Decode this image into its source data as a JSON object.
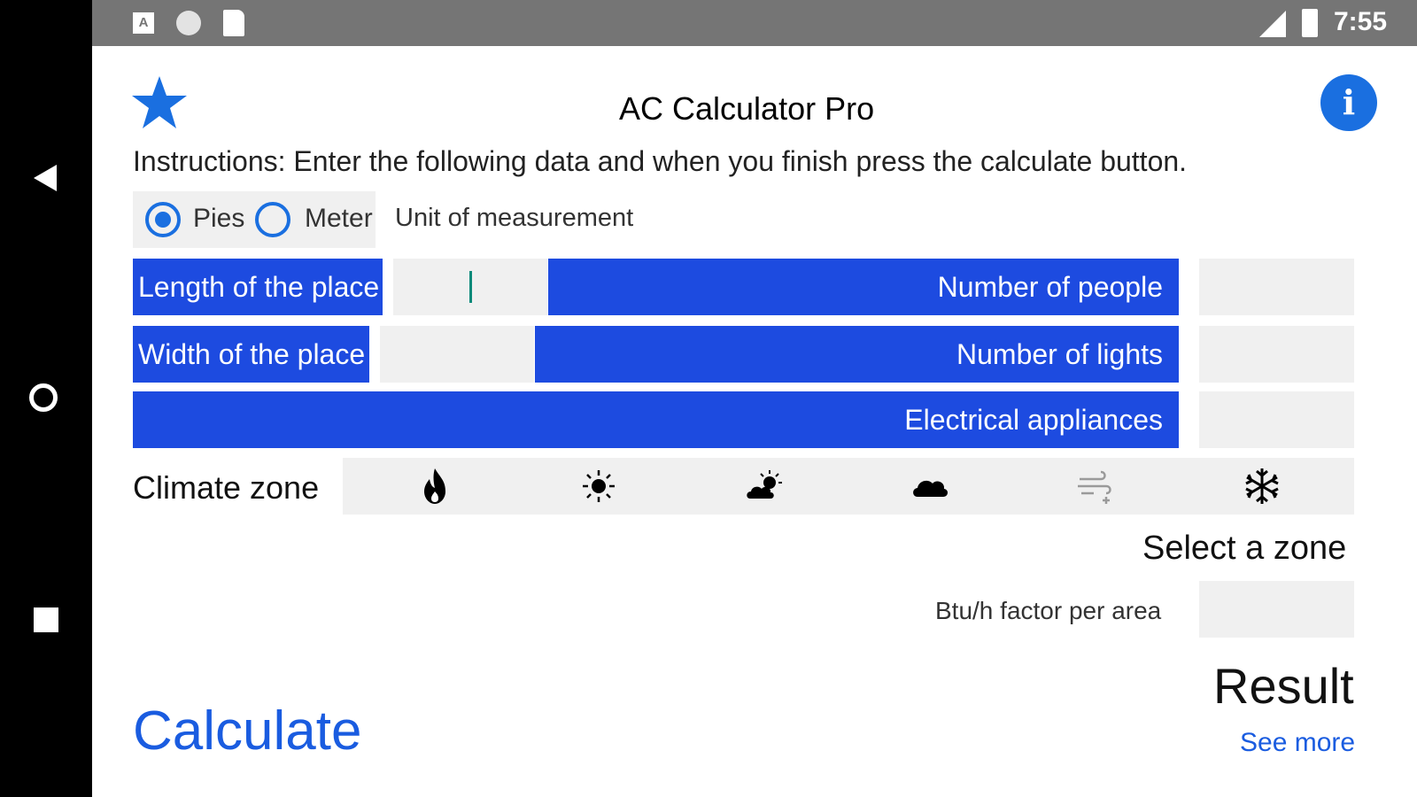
{
  "status_bar": {
    "time": "7:55",
    "notification_icons": [
      "text-a-icon",
      "circle-icon",
      "sd-card-icon"
    ],
    "right_icons": [
      "no-signal-icon",
      "battery-icon"
    ]
  },
  "nav_bar": {
    "icons": [
      "back-icon",
      "home-icon",
      "recents-icon"
    ]
  },
  "header": {
    "title": "AC Calculator Pro",
    "left_icon": "star-icon",
    "right_icon": "info-icon"
  },
  "instructions": "Instructions: Enter the following data and when you finish press the calculate button.",
  "unit": {
    "options": [
      {
        "label": "Pies",
        "selected": true
      },
      {
        "label": "Meter",
        "selected": false
      }
    ],
    "caption": "Unit of measurement"
  },
  "fields": {
    "length": {
      "label": "Length of the place",
      "value": ""
    },
    "people": {
      "label": "Number of people",
      "value": ""
    },
    "width": {
      "label": "Width of the place",
      "value": ""
    },
    "lights": {
      "label": "Number of lights",
      "value": ""
    },
    "appliances": {
      "label": "Electrical appliances",
      "value": ""
    }
  },
  "climate": {
    "label": "Climate zone",
    "zones": [
      "fire-icon",
      "sun-icon",
      "partly-cloudy-icon",
      "cloud-icon",
      "wind-icon",
      "snowflake-icon"
    ],
    "select_label": "Select a zone"
  },
  "btu": {
    "label": "Btu/h factor per area",
    "value": ""
  },
  "result": {
    "label": "Result",
    "see_more": "See more"
  },
  "calculate": {
    "label": "Calculate"
  },
  "colors": {
    "accent": "#1a6fe0",
    "label_bg": "#1d4be0",
    "input_bg": "#f0f0f0",
    "status_bar": "#757575"
  }
}
